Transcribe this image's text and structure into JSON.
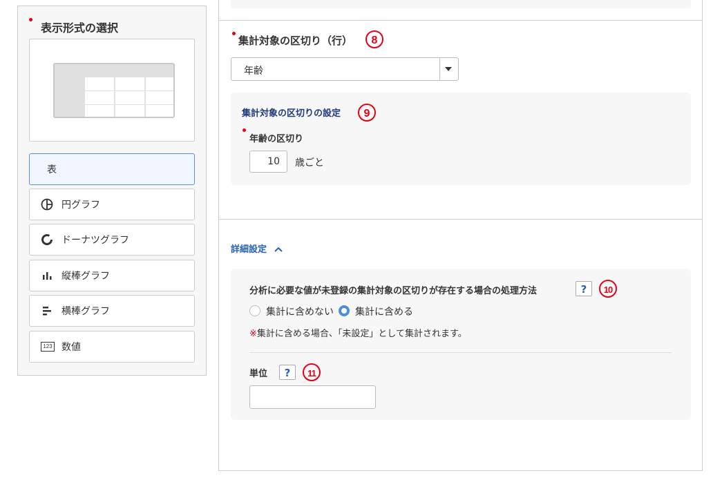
{
  "left_panel": {
    "title": "表示形式の選択",
    "options": [
      {
        "label": "表",
        "icon": "table-icon",
        "selected": true
      },
      {
        "label": "円グラフ",
        "icon": "pie-chart-icon",
        "selected": false
      },
      {
        "label": "ドーナツグラフ",
        "icon": "donut-chart-icon",
        "selected": false
      },
      {
        "label": "縦棒グラフ",
        "icon": "vertical-bar-chart-icon",
        "selected": false
      },
      {
        "label": "横棒グラフ",
        "icon": "horizontal-bar-chart-icon",
        "selected": false
      },
      {
        "label": "数値",
        "icon": "number-icon",
        "selected": false
      }
    ],
    "number_icon_text": "123"
  },
  "row_division": {
    "label": "集計対象の区切り（行）",
    "marker": "8",
    "select_value": "年齢",
    "settings_title": "集計対象の区切りの設定",
    "settings_marker": "9",
    "age_label": "年齢の区切り",
    "age_value": "10",
    "age_unit": "歳ごと"
  },
  "details": {
    "toggle_label": "詳細設定",
    "processing_label": "分析に必要な値が未登録の集計対象の区切りが存在する場合の処理方法",
    "help_symbol": "?",
    "processing_marker": "10",
    "radio_exclude": "集計に含めない",
    "radio_include": "集計に含める",
    "selected_radio": "集計に含める",
    "note_mark": "※",
    "note_text": "集計に含める場合、「未設定」として集計されます。",
    "unit_label": "単位",
    "unit_marker": "11",
    "unit_value": ""
  },
  "colors": {
    "required": "#e60012",
    "accent": "#4a90d9",
    "link": "#2a62b3",
    "selected_bg": "#f1f6fe"
  }
}
